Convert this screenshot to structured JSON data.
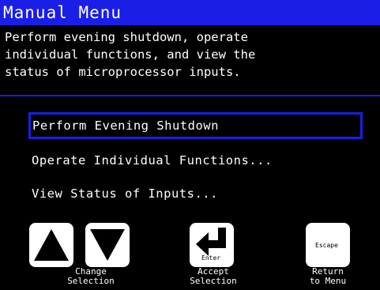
{
  "title": "Manual Menu",
  "description": "Perform evening shutdown, operate\nindividual functions, and view the\nstatus of microprocessor inputs.",
  "menu": {
    "items": [
      {
        "label": "Perform Evening Shutdown",
        "selected": true
      },
      {
        "label": "Operate Individual Functions..."
      },
      {
        "label": "View Status of Inputs..."
      }
    ]
  },
  "keys": {
    "enter_label": "Enter",
    "escape_label": "Escape",
    "change_caption_1": "Change",
    "change_caption_2": "Selection",
    "accept_caption_1": "Accept",
    "accept_caption_2": "Selection",
    "return_caption_1": "Return",
    "return_caption_2": "to Menu"
  },
  "colors": {
    "accent": "#1a1ee6",
    "background": "#000000",
    "text": "#ffffff"
  },
  "icons": [
    "up-arrow-icon",
    "down-arrow-icon",
    "enter-return-icon"
  ]
}
